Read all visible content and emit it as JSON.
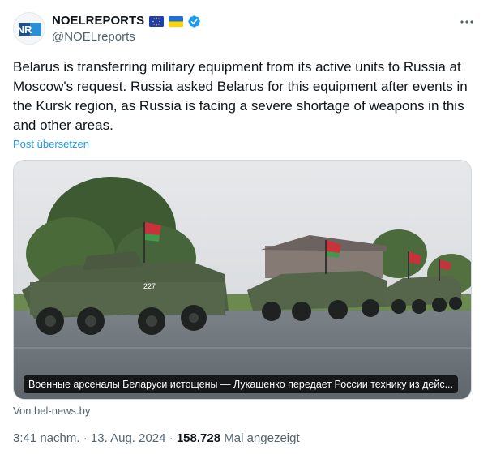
{
  "author": {
    "display_name": "NOELREPORTS",
    "handle": "@NOELreports",
    "avatar_text": "NR",
    "flags": [
      "eu-flag",
      "ukraine-flag"
    ],
    "verified_color": "#1d9bf0"
  },
  "menu": {
    "icon": "more-horizontal-icon"
  },
  "tweet": {
    "text": "Belarus is transferring military equipment from its active units to Russia at Moscow's request. Russia asked Belarus for this equipment after events in the Kursk region, as Russia is facing a severe shortage of weapons in this and other areas.",
    "translate_label": "Post übersetzen"
  },
  "media": {
    "vehicle_number": "227",
    "caption": "Военные арсеналы Беларуси истощены — Лукашенко передает России технику из дейс...",
    "source": "Von bel-news.by"
  },
  "meta": {
    "time": "3:41 nachm.",
    "sep1": " · ",
    "date": "13. Aug. 2024",
    "sep2": " · ",
    "views": "158.728",
    "views_label": " Mal angezeigt"
  },
  "colors": {
    "link": "#1d9bf0",
    "secondary_text": "#536471",
    "primary_text": "#0f1419",
    "border": "#cfd9de"
  }
}
